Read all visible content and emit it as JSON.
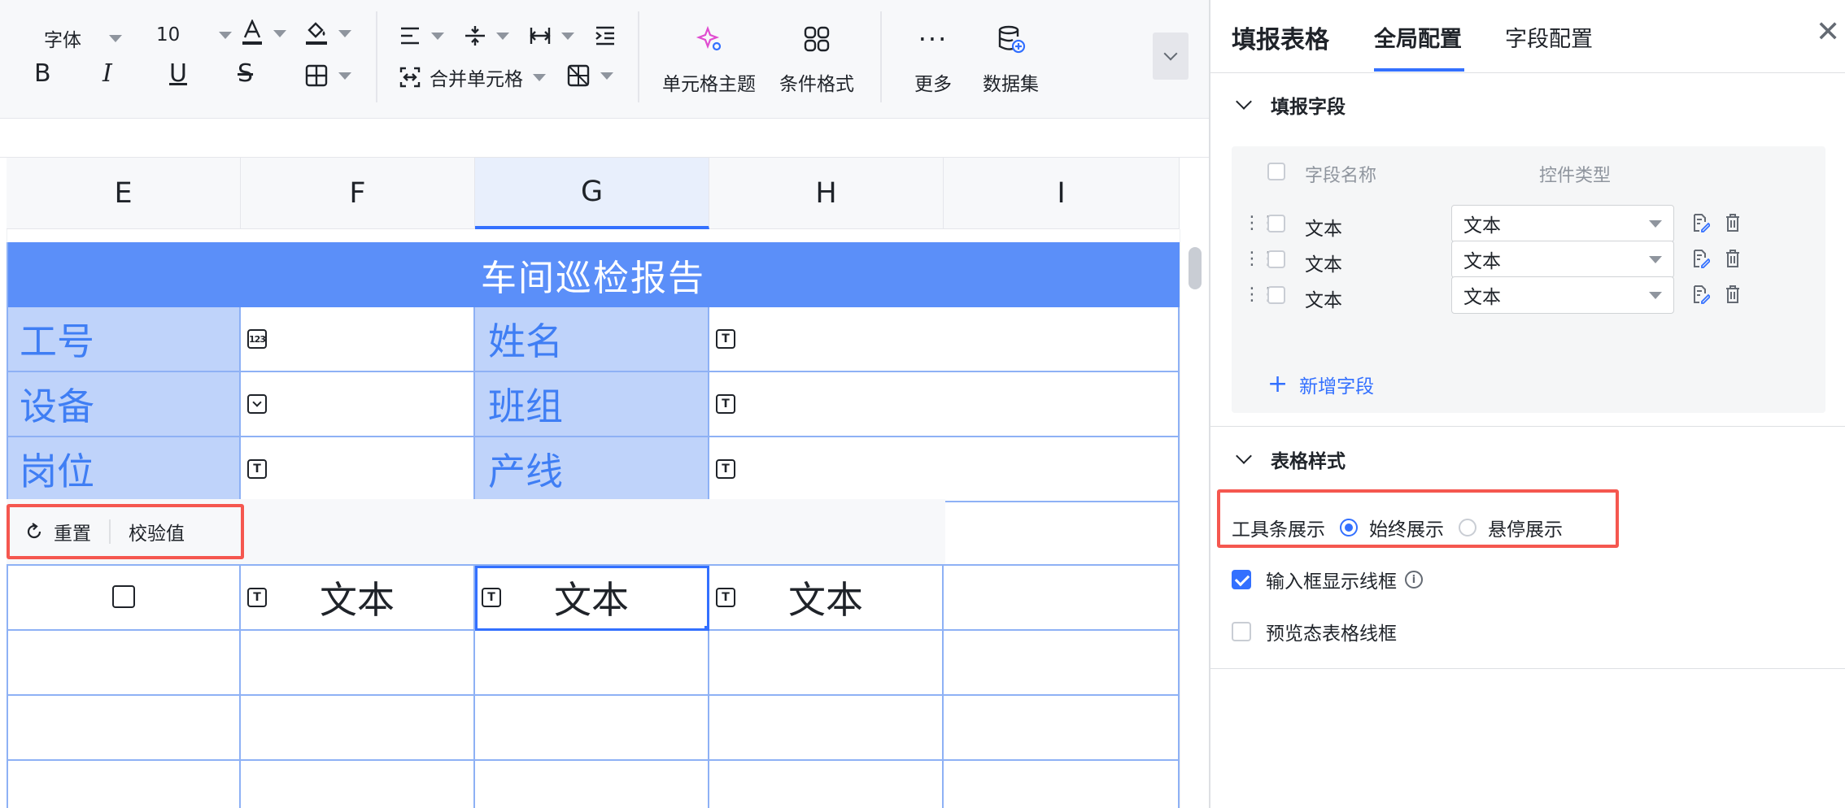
{
  "toolbar": {
    "font_family": "字体",
    "font_size": "10",
    "merge_cells": "合并单元格",
    "cell_theme": "单元格主题",
    "conditional_format": "条件格式",
    "more": "更多",
    "dataset": "数据集"
  },
  "columns": [
    "E",
    "F",
    "G",
    "H",
    "I"
  ],
  "sheet": {
    "title": "车间巡检报告",
    "labels": {
      "r1c1": "工号",
      "r1c3": "姓名",
      "r2c1": "设备",
      "r2c3": "班组",
      "r3c1": "岗位",
      "r3c3": "产线"
    },
    "chips": {
      "number": "123",
      "text": "T"
    },
    "data_row": [
      "文本",
      "文本",
      "文本"
    ]
  },
  "row_toolbar": {
    "reset": "重置",
    "validate": "校验值"
  },
  "panel": {
    "title": "填报表格",
    "tabs": [
      "全局配置",
      "字段配置"
    ],
    "fields_section": "填报字段",
    "field_col_name": "字段名称",
    "field_col_type": "控件类型",
    "fields": [
      {
        "name": "文本",
        "type": "文本"
      },
      {
        "name": "文本",
        "type": "文本"
      },
      {
        "name": "文本",
        "type": "文本"
      }
    ],
    "add_field": "新增字段",
    "style_section": "表格样式",
    "toolbar_display_label": "工具条展示",
    "toolbar_display_options": [
      "始终展示",
      "悬停展示"
    ],
    "toolbar_display_selected": "始终展示",
    "show_input_border": "输入框显示线框",
    "show_input_border_checked": true,
    "preview_border": "预览态表格线框",
    "preview_border_checked": false
  },
  "colors": {
    "accent": "#3370ff",
    "title_bar": "#5b8ff9",
    "label_cell": "#bfd3fa",
    "label_text": "#3f7ef4",
    "highlight_box": "#f5574f"
  }
}
